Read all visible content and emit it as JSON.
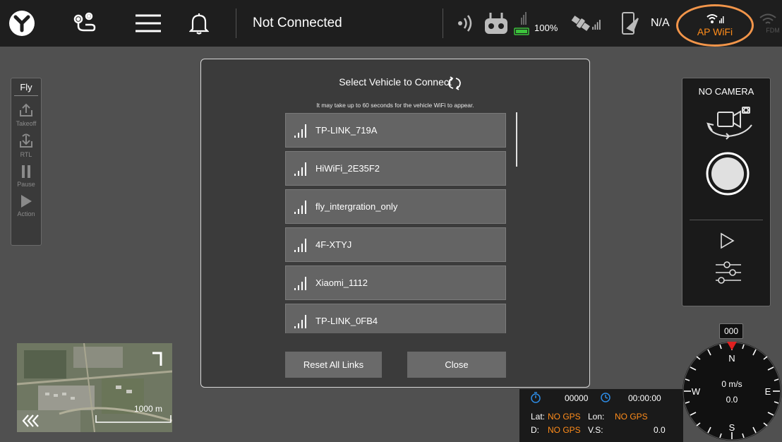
{
  "topbar": {
    "status": "Not Connected",
    "battery": "100%",
    "na": "N/A",
    "ap_wifi": "AP WiFi",
    "fdm": "FDM"
  },
  "fly_panel": {
    "title": "Fly",
    "buttons": [
      "Takeoff",
      "RTL",
      "Pause",
      "Action"
    ]
  },
  "dialog": {
    "title": "Select Vehicle to Connect",
    "subtitle": "It may take up to 60 seconds for the vehicle WiFi to appear.",
    "networks": [
      "TP-LINK_719A",
      "HiWiFi_2E35F2",
      "fly_intergration_only",
      "4F-XTYJ",
      "Xiaomi_1112",
      "TP-LINK_0FB4"
    ],
    "reset_label": "Reset All Links",
    "close_label": "Close"
  },
  "camera": {
    "title": "NO CAMERA"
  },
  "map": {
    "scale": "1000 m"
  },
  "telemetry": {
    "counter": "00000",
    "time": "00:00:00",
    "lat_label": "Lat:",
    "lat_value": "NO GPS",
    "lon_label": "Lon:",
    "lon_value": "NO GPS",
    "d_label": "D:",
    "d_value": "NO GPS",
    "vs_label": "V.S:",
    "vs_value": "0.0"
  },
  "compass": {
    "heading": "000",
    "n": "N",
    "e": "E",
    "s": "S",
    "w": "W",
    "speed": "0 m/s",
    "speed_value": "0.0"
  },
  "colors": {
    "accent_orange": "#ff8c1a",
    "highlight_ring": "#f2954a",
    "battery_green": "#3cc43c",
    "compass_red": "#e02020"
  }
}
